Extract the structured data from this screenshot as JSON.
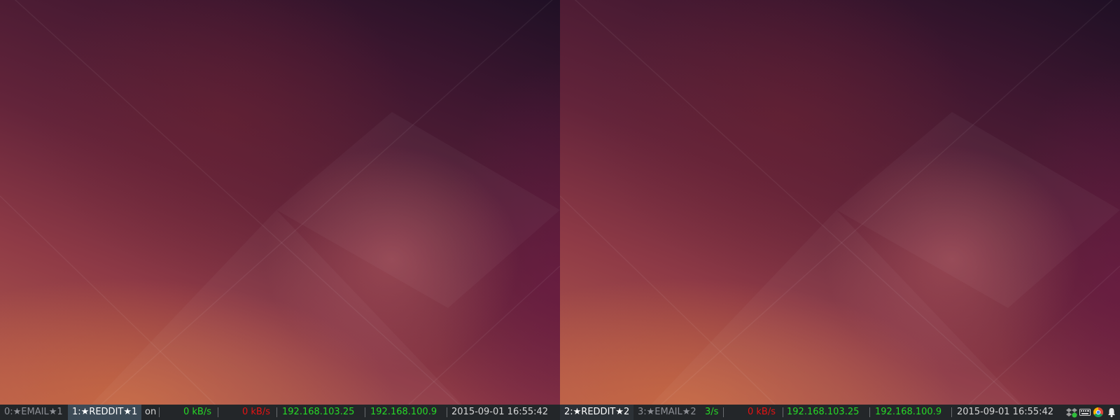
{
  "screens": [
    {
      "panel": {
        "workspaces": [
          {
            "label": "0:★EMAIL★1",
            "active": false
          },
          {
            "label": "1:★REDDIT★1",
            "active": true
          }
        ],
        "window_title_fragment": "on",
        "net_up": "0 kB/s",
        "net_down": "0 kB/s",
        "ip_1": "192.168.103.25",
        "ip_2": "192.168.100.9",
        "datetime": "2015-09-01 16:55:42"
      }
    },
    {
      "panel": {
        "workspaces": [
          {
            "label": "2:★REDDIT★2",
            "active": true
          },
          {
            "label": "3:★EMAIL★2",
            "active": false
          }
        ],
        "net_up": "3/s",
        "net_down": "0 kB/s",
        "ip_1": "192.168.103.25",
        "ip_2": "192.168.100.9",
        "datetime": "2015-09-01 16:55:42",
        "tray_icons": [
          "dropbox-icon",
          "keyboard-icon",
          "chrome-icon",
          "notification-bell-icon"
        ]
      }
    }
  ],
  "colors": {
    "panel_bg": "#232629",
    "ok_green": "#27d827",
    "alert_red": "#e41313",
    "active_workspace_bg": "#3c4a56"
  }
}
